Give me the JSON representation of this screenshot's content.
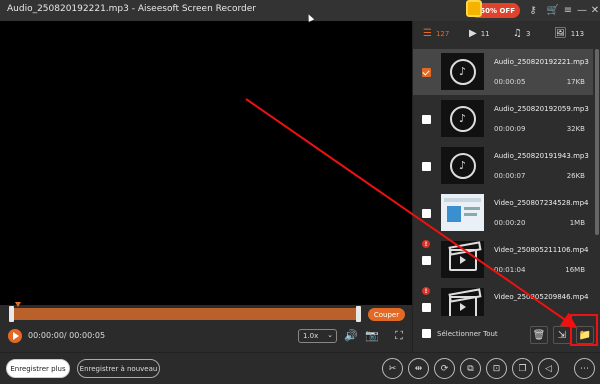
{
  "window": {
    "title": "Audio_250820192221.mp3 - Aiseesoft Screen Recorder",
    "promo_label": "50% OFF"
  },
  "titlebar_icons": [
    "gift-icon",
    "key-icon",
    "cart-icon",
    "menu-icon",
    "minimize-icon",
    "close-icon"
  ],
  "player": {
    "time_display": "00:00:00/ 00:00:05",
    "cut_label": "Couper",
    "speed_value": "1.0x",
    "progress": 0
  },
  "tabs": [
    {
      "icon": "list-icon",
      "count": "127",
      "active": true
    },
    {
      "icon": "video-icon",
      "count": "11",
      "active": false
    },
    {
      "icon": "music-icon",
      "count": "3",
      "active": false
    },
    {
      "icon": "image-icon",
      "count": "113",
      "active": false
    }
  ],
  "files": [
    {
      "name": "Audio_250820192221.mp3",
      "duration": "00:00:05",
      "size": "17KB",
      "thumb": "audio",
      "checked": true,
      "selected": true,
      "warning": false
    },
    {
      "name": "Audio_250820192059.mp3",
      "duration": "00:00:09",
      "size": "32KB",
      "thumb": "audio",
      "checked": false,
      "selected": false,
      "warning": false
    },
    {
      "name": "Audio_250820191943.mp3",
      "duration": "00:00:07",
      "size": "26KB",
      "thumb": "audio",
      "checked": false,
      "selected": false,
      "warning": false
    },
    {
      "name": "Video_250807234528.mp4",
      "duration": "00:00:20",
      "size": "1MB",
      "thumb": "web",
      "checked": false,
      "selected": false,
      "warning": false
    },
    {
      "name": "Video_250805211106.mp4",
      "duration": "00:01:04",
      "size": "16MB",
      "thumb": "clap",
      "checked": false,
      "selected": false,
      "warning": true
    },
    {
      "name": "Video_250805209846.mp4",
      "duration": "",
      "size": "",
      "thumb": "clap",
      "checked": false,
      "selected": false,
      "warning": true
    }
  ],
  "panel_footer": {
    "select_all_label": "Sélectionner Tout",
    "buttons": [
      "trash-icon",
      "export-icon",
      "folder-icon"
    ]
  },
  "bottom": {
    "save_more_label": "Enregistrer plus",
    "rerecord_label": "Enregistrer à nouveau",
    "tools": [
      "scissors-icon",
      "split-icon",
      "convert-icon",
      "compress-icon",
      "merge-icon",
      "copy-icon",
      "volume-down-icon",
      "volume-up-icon",
      "more-icon"
    ]
  },
  "colors": {
    "accent": "#e26a26",
    "annotation": "#e11111"
  }
}
